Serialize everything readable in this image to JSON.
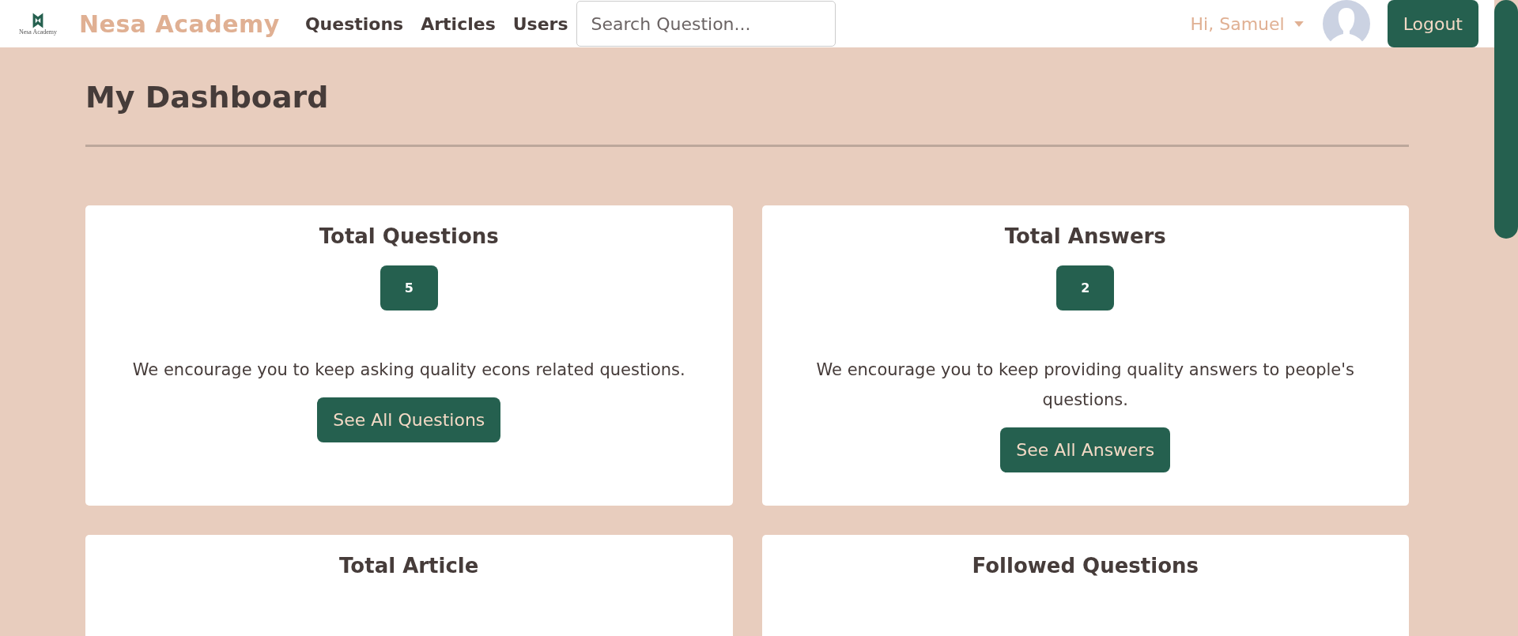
{
  "navbar": {
    "logo_caption": "Nesa Academy",
    "brand": "Nesa Academy",
    "links": [
      "Questions",
      "Articles",
      "Users"
    ],
    "search": {
      "placeholder": "Search Question..."
    },
    "greeting": "Hi, Samuel",
    "logout": "Logout"
  },
  "page_title": "My Dashboard",
  "cards": [
    {
      "title": "Total Questions",
      "count": "5",
      "text": "We encourage you to keep asking quality econs related questions.",
      "button": "See All Questions"
    },
    {
      "title": "Total Answers",
      "count": "2",
      "text": "We encourage you to keep providing quality answers to people's questions.",
      "button": "See All Answers"
    },
    {
      "title": "Total Article"
    },
    {
      "title": "Followed Questions"
    }
  ]
}
